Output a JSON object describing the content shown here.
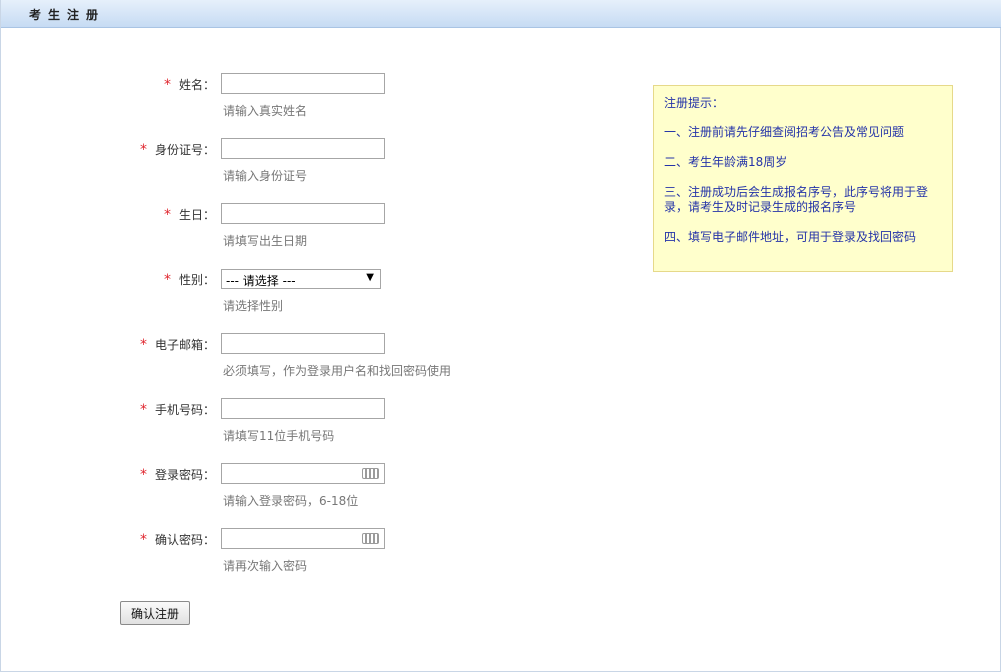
{
  "header": {
    "title": "考生注册"
  },
  "form": {
    "fields": [
      {
        "label": "姓名：",
        "hint": "请输入真实姓名",
        "value": ""
      },
      {
        "label": "身份证号：",
        "hint": "请输入身份证号",
        "value": ""
      },
      {
        "label": "生日：",
        "hint": "请填写出生日期",
        "value": ""
      },
      {
        "label": "性别：",
        "hint": "请选择性别",
        "selected": "--- 请选择 ---"
      },
      {
        "label": "电子邮箱：",
        "hint": "必须填写，作为登录用户名和找回密码使用",
        "value": ""
      },
      {
        "label": "手机号码：",
        "hint": "请填写11位手机号码",
        "value": ""
      },
      {
        "label": "登录密码：",
        "hint": "请输入登录密码，6-18位",
        "value": ""
      },
      {
        "label": "确认密码：",
        "hint": "请再次输入密码",
        "value": ""
      }
    ],
    "required_mark": "*",
    "submit_label": "确认注册"
  },
  "tips": {
    "title": "注册提示：",
    "items": [
      "一、注册前请先仔细查阅招考公告及常见问题",
      "二、考生年龄满18周岁",
      "三、注册成功后会生成报名序号，此序号将用于登录，请考生及时记录生成的报名序号",
      "四、填写电子邮件地址，可用于登录及找回密码"
    ]
  },
  "colors": {
    "required": "#e0262e",
    "tips_text": "#2433a8",
    "tips_background": "#ffffcc",
    "header_gradient_top": "#e6f0fb",
    "header_gradient_bottom": "#c6dbf3"
  },
  "icons": {
    "keyboard": "keyboard-icon",
    "dropdown": "dropdown-arrow-icon"
  }
}
